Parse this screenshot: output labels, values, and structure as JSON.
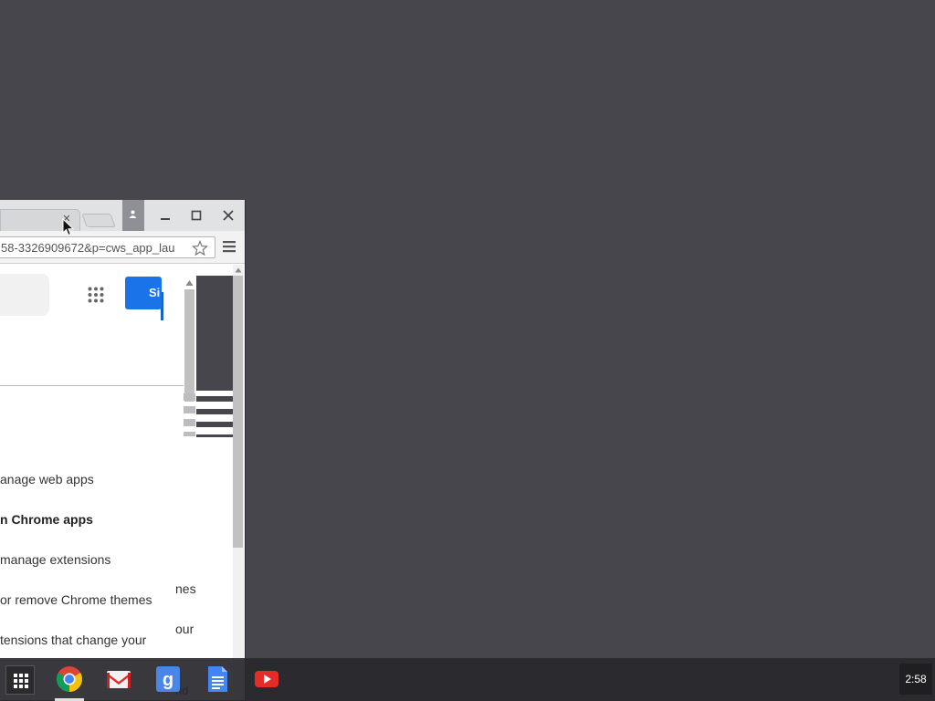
{
  "browser": {
    "url": "58-3326909672&p=cws_app_lau",
    "signin_label": "Si",
    "menu_items": [
      {
        "label": "anage web apps",
        "bold": false
      },
      {
        "label": "n Chrome apps",
        "bold": true
      },
      {
        "label": "manage extensions",
        "bold": false
      },
      {
        "label": "or remove Chrome themes",
        "bold": false
      },
      {
        "label": "tensions that change your",
        "bold": false
      }
    ],
    "side_items": [
      "nes",
      "our"
    ],
    "peek_text": "nd"
  },
  "shelf": {
    "apps": [
      "chrome-icon",
      "gmail-icon",
      "google-search-icon",
      "docs-icon",
      "youtube-icon"
    ],
    "clock": "2:58"
  },
  "colors": {
    "desktop": "#47464c",
    "signin": "#1a73e8",
    "youtube": "#e52d27"
  }
}
